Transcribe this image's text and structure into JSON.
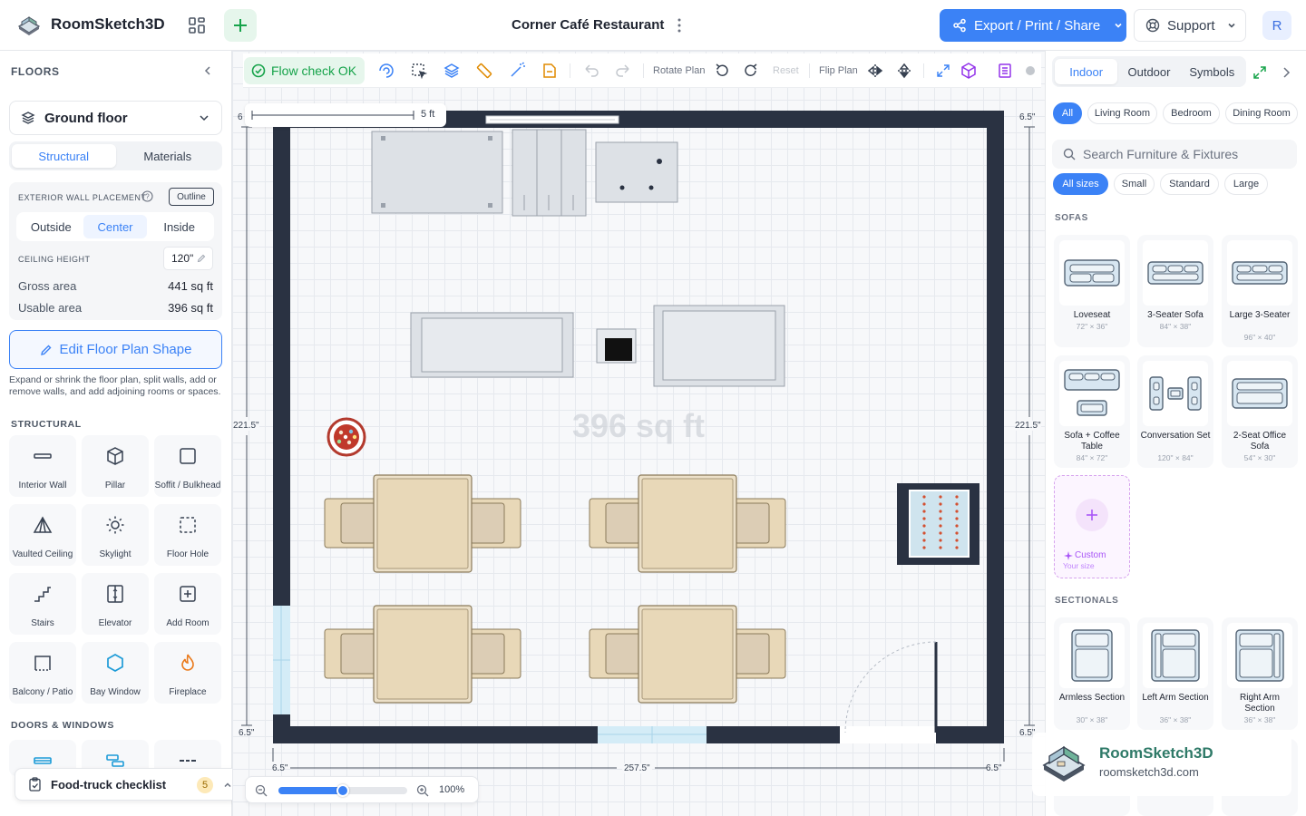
{
  "app": {
    "name": "RoomSketch3D"
  },
  "document": {
    "title": "Corner Café Restaurant"
  },
  "header": {
    "export_label": "Export / Print / Share",
    "support_label": "Support",
    "avatar_initial": "R"
  },
  "left_panel": {
    "section_title": "FLOORS",
    "floor_select": "Ground floor",
    "tabs": [
      "Structural",
      "Materials"
    ],
    "wall_placement": {
      "label": "EXTERIOR WALL PLACEMENT",
      "outline_btn": "Outline",
      "options": [
        "Outside",
        "Center",
        "Inside"
      ],
      "selected": "Center"
    },
    "ceiling": {
      "label": "CEILING HEIGHT",
      "value": "120\""
    },
    "gross": {
      "label": "Gross area",
      "value": "441 sq ft"
    },
    "usable": {
      "label": "Usable area",
      "value": "396 sq ft"
    },
    "edit_button": "Edit Floor Plan Shape",
    "help_text": "Expand or shrink the floor plan, split walls, add or remove walls, and add adjoining rooms or spaces.",
    "structural_title": "STRUCTURAL",
    "tools": [
      "Interior Wall",
      "Pillar",
      "Soffit / Bulkhead",
      "Vaulted Ceiling",
      "Skylight",
      "Floor Hole",
      "Stairs",
      "Elevator",
      "Add Room",
      "Balcony / Patio",
      "Bay Window",
      "Fireplace"
    ],
    "doors_title": "DOORS & WINDOWS",
    "checklist": {
      "label": "Food-truck checklist",
      "count": "5"
    }
  },
  "toolbar": {
    "flow_check": "Flow check OK",
    "rotate_label": "Rotate Plan",
    "reset_label": "Reset",
    "flip_label": "Flip Plan"
  },
  "canvas": {
    "scale_label": "5 ft",
    "room_area": "396 sq ft",
    "dims": {
      "top_left": "6",
      "top_right": "6.5\"",
      "left": "221.5\"",
      "right": "221.5\"",
      "bottom_left": "6.5\"",
      "bottom_right": "6.5\"",
      "width": "257.5\"",
      "bl2": "6.5\"",
      "br2": "6.5\""
    },
    "zoom": {
      "value": "100%",
      "level": 0.5
    }
  },
  "right_panel": {
    "tabs": [
      "Indoor",
      "Outdoor",
      "Symbols"
    ],
    "rooms": [
      "All",
      "Living Room",
      "Bedroom",
      "Dining Room"
    ],
    "search_placeholder": "Search Furniture & Fixtures",
    "sizes": [
      "All sizes",
      "Small",
      "Standard",
      "Large"
    ],
    "sofas_title": "SOFAS",
    "sofas": [
      {
        "name": "Loveseat",
        "dims": "72\" × 36\""
      },
      {
        "name": "3-Seater Sofa",
        "dims": "84\" × 38\""
      },
      {
        "name": "Large 3-Seater",
        "dims": "96\" × 40\""
      },
      {
        "name": "Sofa + Coffee Table",
        "dims": "84\" × 72\""
      },
      {
        "name": "Conversation Set",
        "dims": "120\" × 84\""
      },
      {
        "name": "2-Seat Office Sofa",
        "dims": "54\" × 30\""
      }
    ],
    "custom": {
      "name": "Custom",
      "sub": "Your size"
    },
    "sectionals_title": "SECTIONALS",
    "sectionals": [
      {
        "name": "Armless Section",
        "dims": "30\" × 38\""
      },
      {
        "name": "Left Arm Section",
        "dims": "36\" × 38\""
      },
      {
        "name": "Right Arm Section",
        "dims": "36\" × 38\""
      }
    ]
  },
  "watermark": {
    "name": "RoomSketch3D",
    "url": "roomsketch3d.com"
  },
  "colors": {
    "accent": "#3b82f6",
    "wall": "#2a3242",
    "wood": "#e8d8b8",
    "success": "#16a34a"
  }
}
